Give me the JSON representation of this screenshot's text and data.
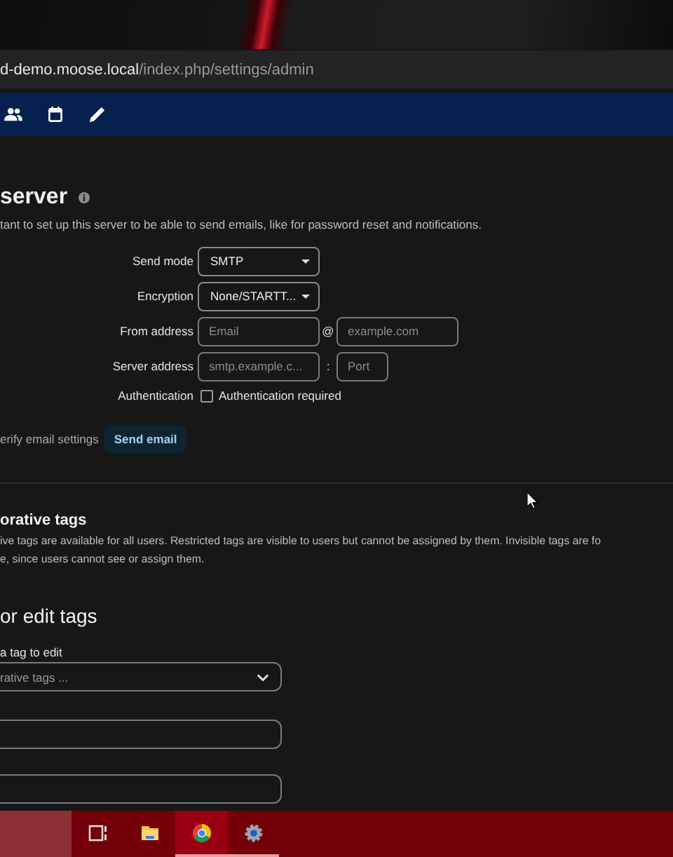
{
  "browser": {
    "url_host": "d-demo.moose.local",
    "url_path": "/index.php/settings/admin"
  },
  "email_server": {
    "title": "server",
    "description": "tant to set up this server to be able to send emails, like for password reset and notifications.",
    "fields": [
      {
        "kind": "select",
        "label": "Send mode",
        "value": "SMTP"
      },
      {
        "kind": "select",
        "label": "Encryption",
        "value": "None/STARTT..."
      },
      {
        "kind": "address",
        "label": "From address",
        "placeholder": "Email",
        "separator": "@",
        "placeholder_2": "example.com"
      },
      {
        "kind": "host_port",
        "label": "Server address",
        "placeholder": "smtp.example.c...",
        "separator": ":",
        "placeholder_2": "Port"
      },
      {
        "kind": "checkbox",
        "label": "Authentication",
        "text": "Authentication required",
        "checked": false
      }
    ],
    "verify_label": "erify email settings",
    "verify_button": "Send email"
  },
  "collaborative_tags": {
    "title": "orative tags",
    "description": [
      "ive tags are available for all users. Restricted tags are visible to users but cannot be assigned by them. Invisible tags are fo",
      "e, since users cannot see or assign them."
    ]
  },
  "edit_tags": {
    "title": "or edit tags",
    "select_label": "a tag to edit",
    "select_placeholder": "rative tags ..."
  },
  "taskbar": [
    {
      "kind": "taskview",
      "selected": false,
      "running": false
    },
    {
      "kind": "folder",
      "selected": false,
      "running": false
    },
    {
      "kind": "browser",
      "selected": true,
      "running": true
    },
    {
      "kind": "settings",
      "selected": false,
      "running": true
    }
  ]
}
